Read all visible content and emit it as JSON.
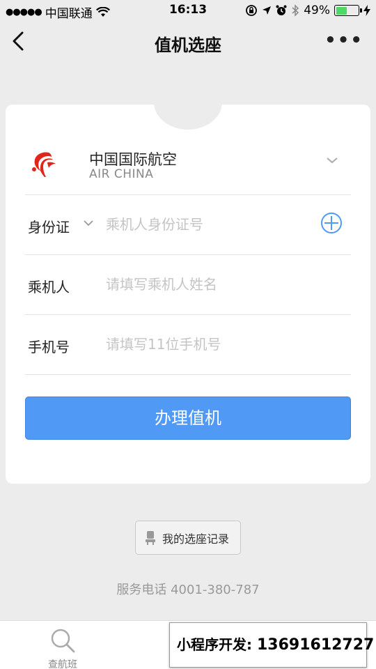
{
  "status_bar": {
    "signal_dots": "●●●●●",
    "carrier": "中国联通",
    "time": "16:13",
    "battery_percent": "49%",
    "battery_level": 0.49,
    "battery_color": "#4cd964"
  },
  "nav": {
    "title": "值机选座",
    "back_icon": "chevron-left-icon",
    "more_icon": "more-icon",
    "more_glyph": "•••"
  },
  "airline": {
    "name": "中国国际航空",
    "name_en": "AIR CHINA",
    "logo_color": "#e1251b"
  },
  "form": {
    "id_type_label": "身份证",
    "id_placeholder": "乘机人身份证号",
    "passenger_label": "乘机人",
    "passenger_placeholder": "请填写乘机人姓名",
    "phone_label": "手机号",
    "phone_placeholder": "请填写11位手机号"
  },
  "checkin_button": {
    "label": "办理值机",
    "color": "#5099f5"
  },
  "records_button": {
    "label": "我的选座记录"
  },
  "service_phone": "服务电话 4001-380-787",
  "tabs": [
    {
      "label": "查航班",
      "icon": "search-icon"
    }
  ],
  "watermark": {
    "prefix": "小程序开发:",
    "number": "13691612727"
  },
  "colors": {
    "accent": "#5099f5",
    "background": "#ececec"
  }
}
